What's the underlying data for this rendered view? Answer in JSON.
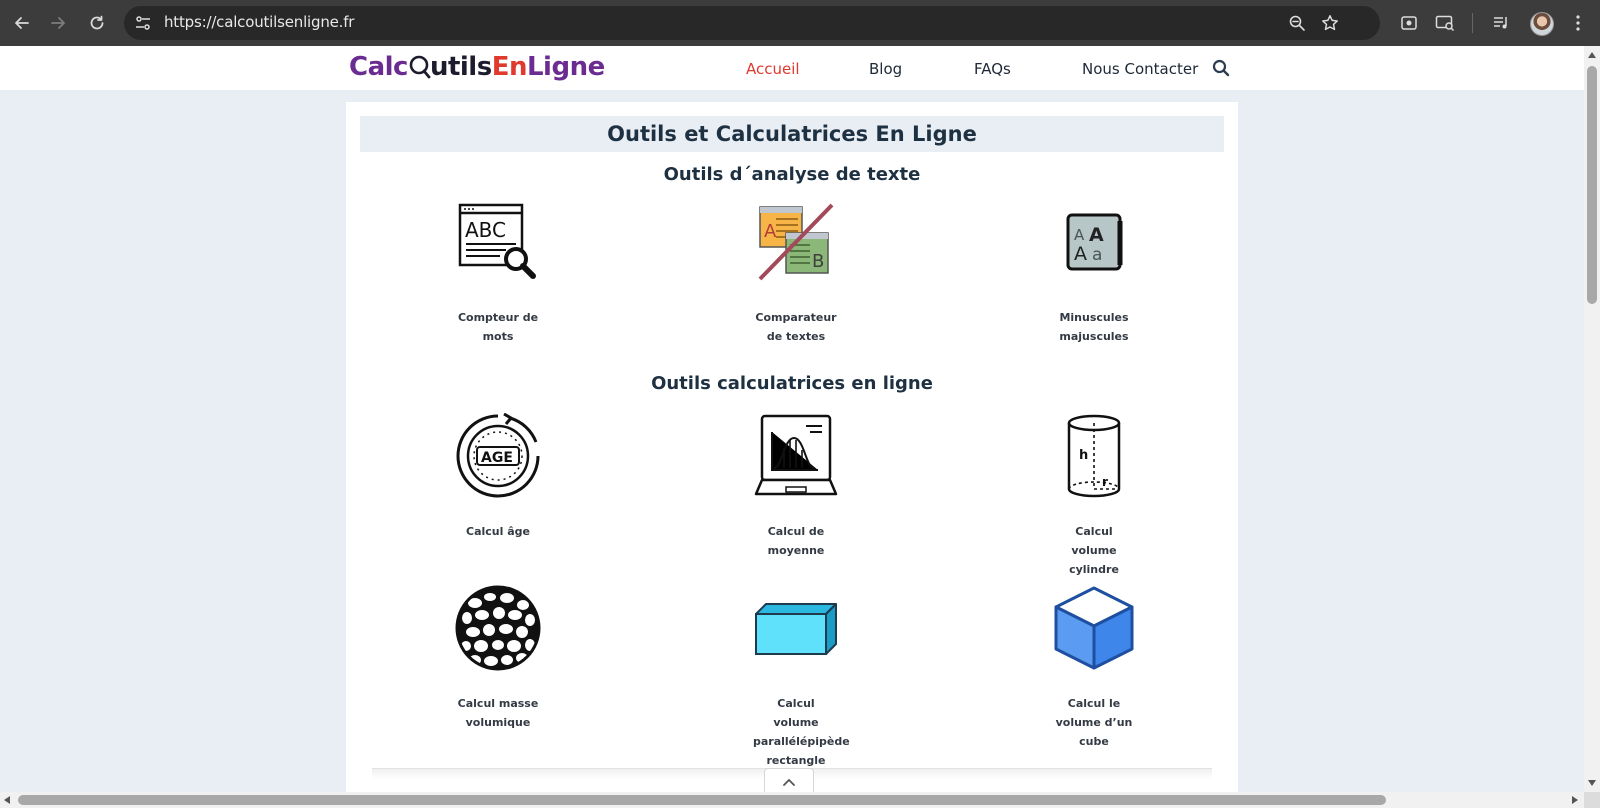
{
  "browser": {
    "url": "https://calcoutilsenligne.fr"
  },
  "header": {
    "logo": {
      "part1": "Calc",
      "part2": "utils",
      "part3": "En",
      "part4": "Ligne"
    },
    "nav": [
      "Accueil",
      "Blog",
      "FAQs",
      "Nous Contacter"
    ],
    "active_index": 0
  },
  "main": {
    "title": "Outils et Calculatrices En Ligne",
    "sections": [
      {
        "title": "Outils d´analyse de texte",
        "tools": [
          {
            "icon": "word-counter-icon",
            "label": "Compteur de mots"
          },
          {
            "icon": "text-compare-icon",
            "label": "Comparateur de textes"
          },
          {
            "icon": "case-converter-icon",
            "label": "Minuscules majuscules"
          }
        ]
      },
      {
        "title": "Outils calculatrices en ligne",
        "tools": [
          {
            "icon": "age-calculator-icon",
            "label": "Calcul âge"
          },
          {
            "icon": "average-calculator-icon",
            "label": "Calcul de moyenne"
          },
          {
            "icon": "cylinder-volume-icon",
            "label": "Calcul volume cylindre"
          },
          {
            "icon": "density-icon",
            "label": "Calcul masse volumique"
          },
          {
            "icon": "cuboid-volume-icon",
            "label": "Calcul volume parallélépipède rectangle"
          },
          {
            "icon": "cube-volume-icon",
            "label": "Calcul le volume d’un cube"
          }
        ]
      }
    ]
  },
  "colors": {
    "logo_purple": "#6a2c91",
    "logo_red": "#e03a2f",
    "logo_dark": "#1c1c2e",
    "nav_active": "#e03a2f",
    "heading": "#1e3142",
    "page_bg": "#e9eef5"
  }
}
